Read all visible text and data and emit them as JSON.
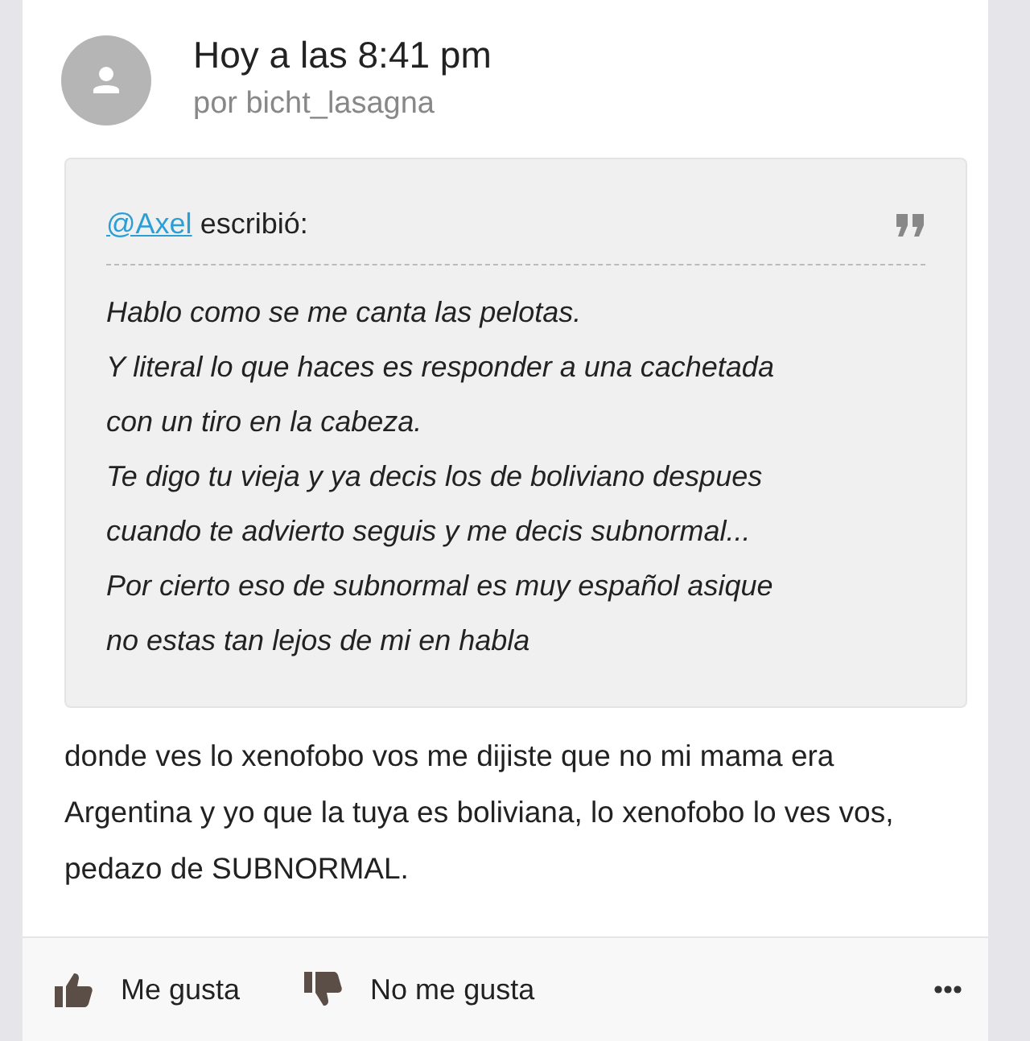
{
  "post": {
    "time": "Hoy a las 8:41 pm",
    "author": "por bicht_lasagna"
  },
  "quote": {
    "mention": "@Axel",
    "verb": "escribió:",
    "lines": [
      "Hablo como se me canta las pelotas.",
      "Y literal lo que haces es responder a una cachetada",
      "con un tiro en la cabeza.",
      "Te digo tu vieja y ya decis los de boliviano despues",
      "cuando te advierto seguis y me decis subnormal...",
      "Por cierto eso de subnormal es muy español asique",
      "no estas tan lejos de mi en habla"
    ]
  },
  "body": "donde ves lo xenofobo vos me dijiste que no mi mama era Argentina y yo que la tuya es boliviana, lo xenofobo lo ves vos, pedazo de SUBNORMAL.",
  "actions": [
    {
      "kind": "like",
      "label": "Me gusta"
    },
    {
      "kind": "dislike",
      "label": "No me gusta"
    }
  ]
}
